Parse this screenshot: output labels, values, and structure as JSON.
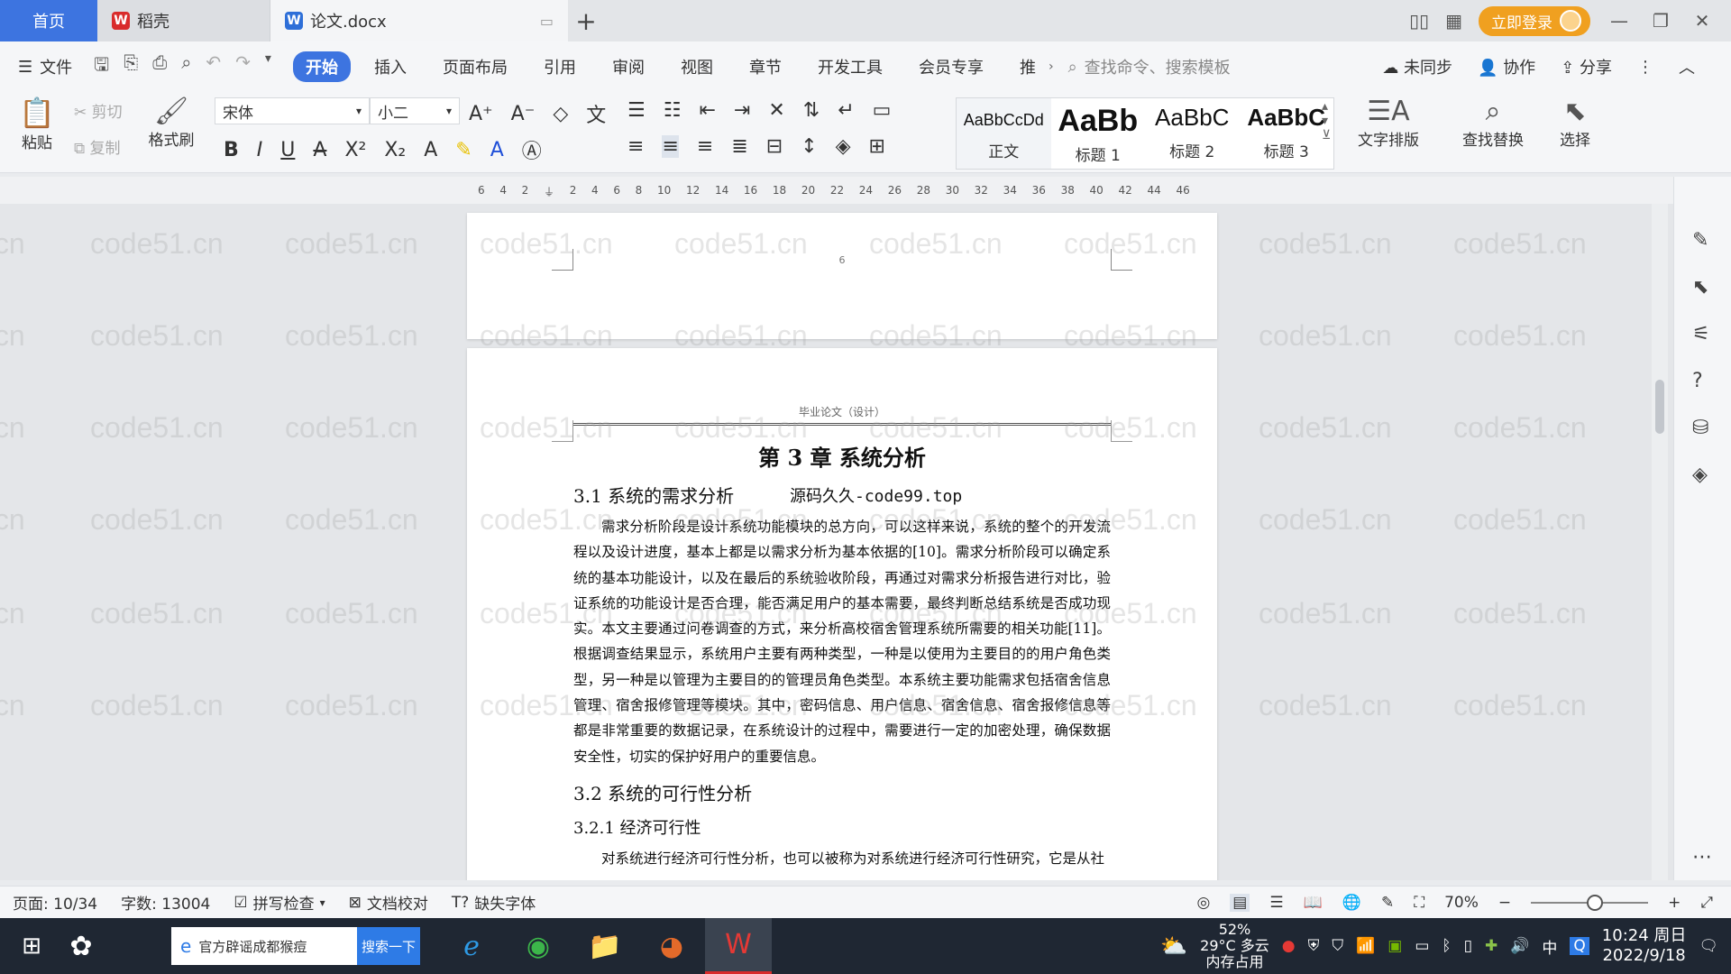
{
  "titlebar": {
    "home_tab": "首页",
    "tabs": [
      {
        "label": "稻壳",
        "icon": "daoke-logo-icon"
      },
      {
        "label": "论文.docx",
        "icon": "wps-writer-icon"
      }
    ],
    "login_label": "立即登录"
  },
  "menubar": {
    "file_label": "文件",
    "tabs": [
      "开始",
      "插入",
      "页面布局",
      "引用",
      "审阅",
      "视图",
      "章节",
      "开发工具",
      "会员专享",
      "推"
    ],
    "active_tab": "开始",
    "search_placeholder": "查找命令、搜索模板",
    "right": {
      "sync": "未同步",
      "collab": "协作",
      "share": "分享"
    }
  },
  "ribbon": {
    "paste": "粘贴",
    "cut": "剪切",
    "copy": "复制",
    "format_painter": "格式刷",
    "font_name": "宋体",
    "font_size": "小二",
    "styles": [
      {
        "sample": "AaBbCcDd",
        "name": "正文"
      },
      {
        "sample": "AaBb",
        "name": "标题 1"
      },
      {
        "sample": "AaBbC",
        "name": "标题 2"
      },
      {
        "sample": "AaBbC",
        "name": "标题 3"
      }
    ],
    "text_layout": "文字排版",
    "find_replace": "查找替换",
    "select": "选择"
  },
  "ruler": {
    "ticks": [
      "6",
      "4",
      "2",
      "",
      "2",
      "4",
      "6",
      "8",
      "10",
      "12",
      "14",
      "16",
      "18",
      "20",
      "22",
      "24",
      "26",
      "28",
      "30",
      "32",
      "34",
      "36",
      "38",
      "40",
      "42",
      "44",
      "46"
    ]
  },
  "document": {
    "prev_page_number": "6",
    "header": "毕业论文（设计）",
    "chapter_title": "第 3 章  系统分析",
    "section_1": "3.1 系统的需求分析",
    "section_1_note": "源码久久-code99.top",
    "paragraph_1": "需求分析阶段是设计系统功能模块的总方向，可以这样来说，系统的整个的开发流程以及设计进度，基本上都是以需求分析为基本依据的[10]。需求分析阶段可以确定系统的基本功能设计，以及在最后的系统验收阶段，再通过对需求分析报告进行对比，验证系统的功能设计是否合理，能否满足用户的基本需要，最终判断总结系统是否成功现实。本文主要通过问卷调查的方式，来分析高校宿舍管理系统所需要的相关功能[11]。根据调查结果显示，系统用户主要有两种类型，一种是以使用为主要目的的用户角色类型，另一种是以管理为主要目的的管理员角色类型。本系统主要功能需求包括宿舍信息管理、宿舍报修管理等模块。其中，密码信息、用户信息、宿舍信息、宿舍报修信息等都是非常重要的数据记录，在系统设计的过程中，需要进行一定的加密处理，确保数据安全性，切实的保护好用户的重要信息。",
    "section_2": "3.2 系统的可行性分析",
    "section_2_1": "3.2.1 经济可行性",
    "paragraph_2": "对系统进行经济可行性分析，也可以被称为对系统进行经济可行性研究，它是从社"
  },
  "watermark_text": "code51.cn",
  "statusbar": {
    "page": "页面: 10/34",
    "words": "字数: 13004",
    "spell_check": "拼写检查",
    "doc_proof": "文档校对",
    "missing_font": "缺失字体",
    "zoom": "70%"
  },
  "taskbar": {
    "search_text": "官方辟谣成都猴痘",
    "search_button": "搜索一下",
    "weather_top": "52%",
    "weather_temp": "29°C 多云",
    "weather_bottom": "内存占用",
    "ime": "中",
    "time": "10:24 周日",
    "date": "2022/9/18"
  },
  "colors": {
    "accent": "#3d74e0",
    "login": "#f0a020",
    "taskbar": "#1f2733"
  }
}
